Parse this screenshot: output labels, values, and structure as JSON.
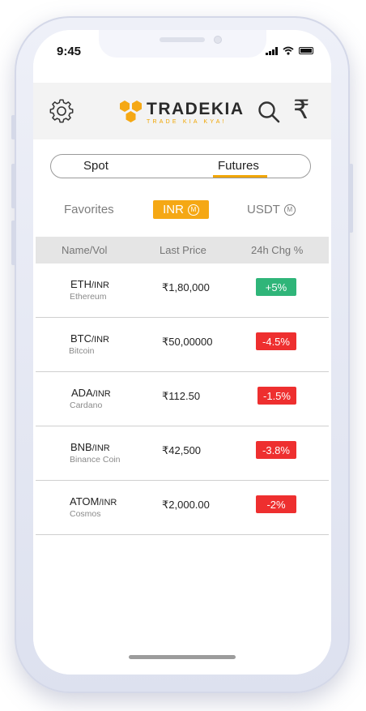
{
  "status_bar": {
    "time": "9:45"
  },
  "header": {
    "logo_text": "TRADEKIA",
    "logo_tagline": "TRADE KIA KYA!",
    "currency_symbol": "₹"
  },
  "market_toggle": {
    "options": [
      "Spot",
      "Futures"
    ],
    "selected": "Futures"
  },
  "quote_tabs": {
    "favorites": "Favorites",
    "inr": "INR",
    "usdt": "USDT",
    "badge": "M",
    "selected": "INR"
  },
  "table": {
    "headers": [
      "Name/Vol",
      "Last Price",
      "24h Chg %"
    ],
    "rows": [
      {
        "base": "ETH",
        "quote": "/INR",
        "name": "Ethereum",
        "price": "₹1,80,000",
        "change": "+5%",
        "direction": "up"
      },
      {
        "base": "BTC",
        "quote": "/INR",
        "name": "Bitcoin",
        "price": "₹50,00000",
        "change": "-4.5%",
        "direction": "down"
      },
      {
        "base": "ADA",
        "quote": "/INR",
        "name": "Cardano",
        "price": "₹112.50",
        "change": "-1.5%",
        "direction": "down"
      },
      {
        "base": "BNB",
        "quote": "/INR",
        "name": "Binance Coin",
        "price": "₹42,500",
        "change": "-3.8%",
        "direction": "down"
      },
      {
        "base": "ATOM",
        "quote": "/INR",
        "name": "Cosmos",
        "price": "₹2,000.00",
        "change": "-2%",
        "direction": "down"
      }
    ]
  },
  "colors": {
    "accent": "#f5a814",
    "up": "#2fb579",
    "down": "#ee2f2f"
  }
}
